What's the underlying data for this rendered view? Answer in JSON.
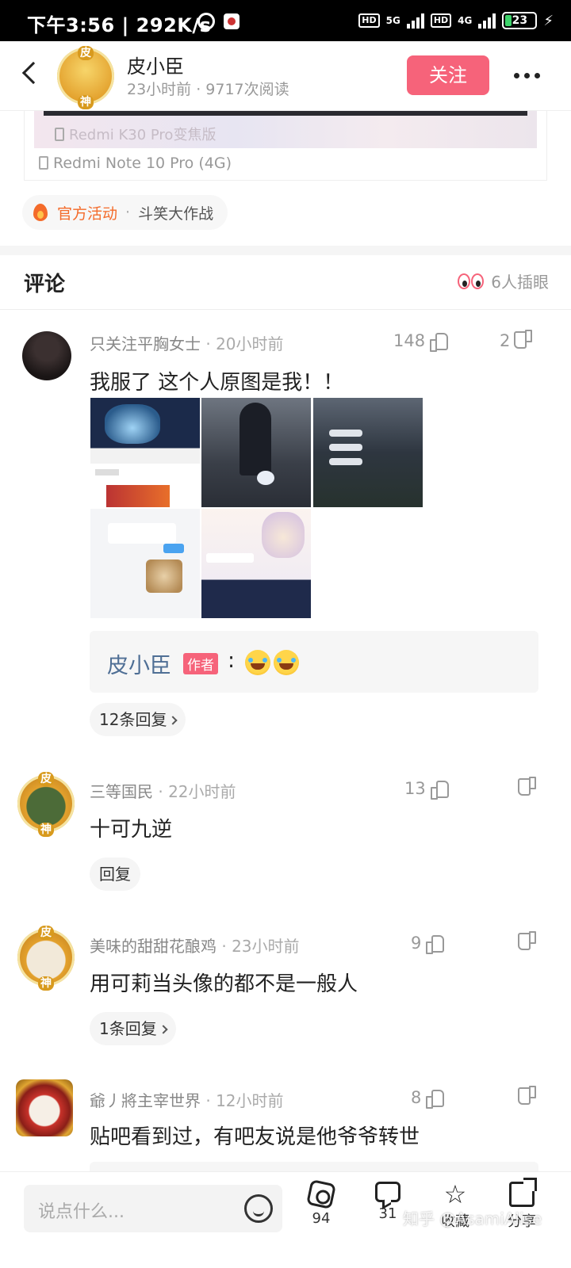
{
  "status_bar": {
    "time_speed": "下午3:56 | 292K/s",
    "hd1": "HD",
    "net1": "5G",
    "hd2": "HD",
    "net2": "4G",
    "battery": "23",
    "battery_level": 0.23
  },
  "header": {
    "author_name": "皮小臣",
    "meta": "23小时前 · 9717次阅读",
    "follow_label": "关注",
    "badge_top": "皮",
    "badge_bottom": "神"
  },
  "post": {
    "device_ghost": "Redmi K30 Pro变焦版",
    "device_label": "Redmi Note 10 Pro (4G)",
    "activity_label": "官方活动",
    "activity_sep": "·",
    "activity_name": "斗笑大作战"
  },
  "comments_section": {
    "title": "评论",
    "watchers": "6人插眼"
  },
  "comments": [
    {
      "user": "只关注平胸女士",
      "time": "· 20小时前",
      "likes": "148",
      "dislikes": "2",
      "text": "我服了 这个人原图是我！！",
      "author_reply": {
        "name": "皮小臣",
        "tag": "作者",
        "colon": ":"
      },
      "replies": "12条回复"
    },
    {
      "user": "三等国民",
      "time": "· 22小时前",
      "likes": "13",
      "text": "十可九逆",
      "replies": "回复"
    },
    {
      "user": "美味的甜甜花酿鸡",
      "time": "· 23小时前",
      "likes": "9",
      "text": "用可莉当头像的都不是一般人",
      "replies": "1条回复"
    },
    {
      "user": "爺丿將主宰世界",
      "time": "· 12小时前",
      "likes": "8",
      "text": "贴吧看到过，有吧友说是他爷爷转世"
    }
  ],
  "bottom_bar": {
    "input_placeholder": "说点什么...",
    "card_count": "94",
    "comment_count": "31",
    "favorite_label": "收藏",
    "share_label": "分享",
    "watermark": "知乎 @AsamiAlise"
  },
  "colors": {
    "accent": "#f6637a",
    "author_link": "#4f6f95",
    "activity": "#f46b2a"
  }
}
